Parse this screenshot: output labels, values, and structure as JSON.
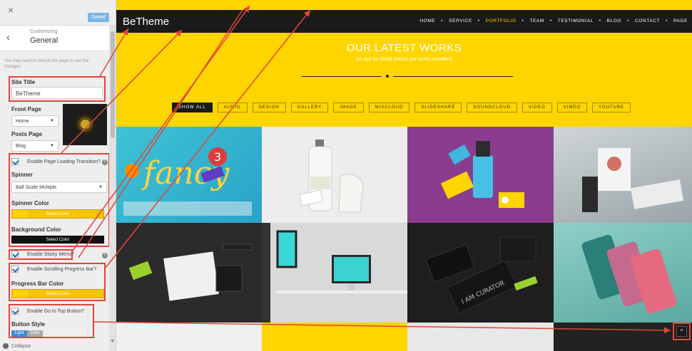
{
  "sidebar": {
    "close_glyph": "×",
    "saved_label": "Saved",
    "back_glyph": "‹",
    "header_small": "Customizing",
    "header_title": "General",
    "notice": "You may need to refresh the page to see the changes.",
    "site_title_label": "Site Title",
    "site_title_value": "BeTheme",
    "front_page_label": "Front Page",
    "front_page_value": "Home",
    "posts_page_label": "Posts Page",
    "posts_page_value": "Blog",
    "loading_transition_label": "Enable Page Loading Transition?",
    "spinner_label": "Spinner",
    "spinner_value": "Ball Scale Multiple",
    "spinner_color_label": "Spinner Color",
    "select_color": "Select Color",
    "background_color_label": "Background Color",
    "sticky_menu_label": "Enable Sticky Menu?",
    "scroll_progress_label": "Enable Scrolling Progress Bar?",
    "progress_bar_color_label": "Progress Bar Color",
    "go_to_top_label": "Enable Go to Top Button?",
    "button_style_label": "Button Style",
    "button_style_light": "Light",
    "button_style_dark": "Dark",
    "collapse_label": "Collapse",
    "help_glyph": "?",
    "caret_glyph": "▼"
  },
  "preview": {
    "brand": "BeTheme",
    "nav": [
      "HOME",
      "SERVICE",
      "PORTFOLIO",
      "TEAM",
      "TESTIMONIAL",
      "BLOG",
      "CONTACT",
      "PAGE"
    ],
    "nav_sep": "•",
    "hero_title": "OUR LATEST WORKS",
    "hero_subtitle": "An eye for detail makes our works excellent",
    "filters": [
      "SHOW ALL",
      "AUDIO",
      "DESIGN",
      "GALLERY",
      "IMAGE",
      "MIXCLOUD",
      "SLIDESHARE",
      "SOUNDCLOUD",
      "VIDEO",
      "VIMEO",
      "YOUTUBE"
    ],
    "to_top_glyph": "^"
  },
  "colors": {
    "accent_yellow": "#ffd500",
    "dark": "#1a1a1a",
    "annotation_red": "#e0453a",
    "saved_blue": "#7ab6e6"
  }
}
